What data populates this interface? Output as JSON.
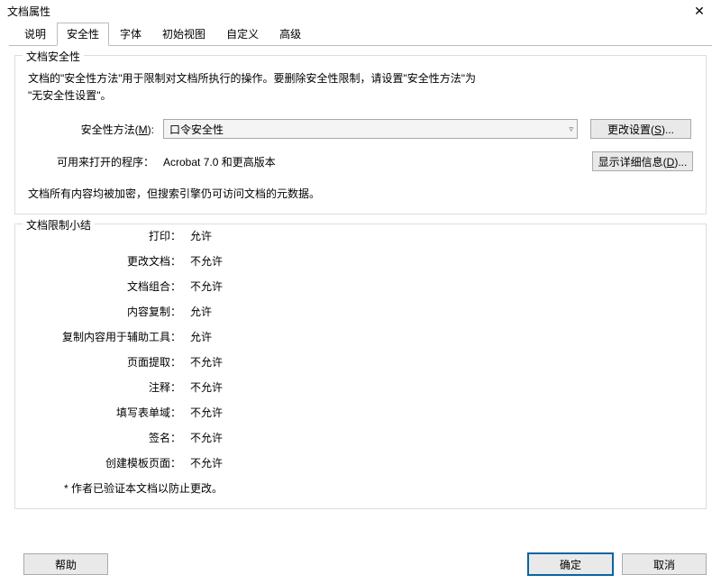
{
  "window": {
    "title": "文档属性",
    "close": "✕"
  },
  "tabs": {
    "t0": "说明",
    "t1": "安全性",
    "t2": "字体",
    "t3": "初始视图",
    "t4": "自定义",
    "t5": "高级"
  },
  "security": {
    "legend": "文档安全性",
    "desc1": "文档的\"安全性方法\"用于限制对文档所执行的操作。要删除安全性限制，请设置\"安全性方法\"为",
    "desc2": "\"无安全性设置\"。",
    "method_label_pre": "安全性方法(",
    "method_label_m": "M",
    "method_label_post": "):",
    "method_value": "口令安全性",
    "change_btn_pre": "更改设置(",
    "change_btn_s": "S",
    "change_btn_post": ")...",
    "opener_label": "可用来打开的程序：",
    "opener_value": "Acrobat 7.0 和更高版本",
    "detail_btn_pre": "显示详细信息(",
    "detail_btn_d": "D",
    "detail_btn_post": ")...",
    "encrypt_note": "文档所有内容均被加密，但搜索引擎仍可访问文档的元数据。"
  },
  "restrict": {
    "legend": "文档限制小结",
    "rows": [
      {
        "label": "打印：",
        "value": "允许"
      },
      {
        "label": "更改文档：",
        "value": "不允许"
      },
      {
        "label": "文档组合：",
        "value": "不允许"
      },
      {
        "label": "内容复制：",
        "value": "允许"
      },
      {
        "label": "复制内容用于辅助工具：",
        "value": "允许"
      },
      {
        "label": "页面提取：",
        "value": "不允许"
      },
      {
        "label": "注释：",
        "value": "不允许"
      },
      {
        "label": "填写表单域：",
        "value": "不允许"
      },
      {
        "label": "签名：",
        "value": "不允许"
      },
      {
        "label": "创建模板页面：",
        "value": "不允许"
      }
    ],
    "verify": "*   作者已验证本文档以防止更改。"
  },
  "buttons": {
    "help": "帮助",
    "ok": "确定",
    "cancel": "取消"
  }
}
